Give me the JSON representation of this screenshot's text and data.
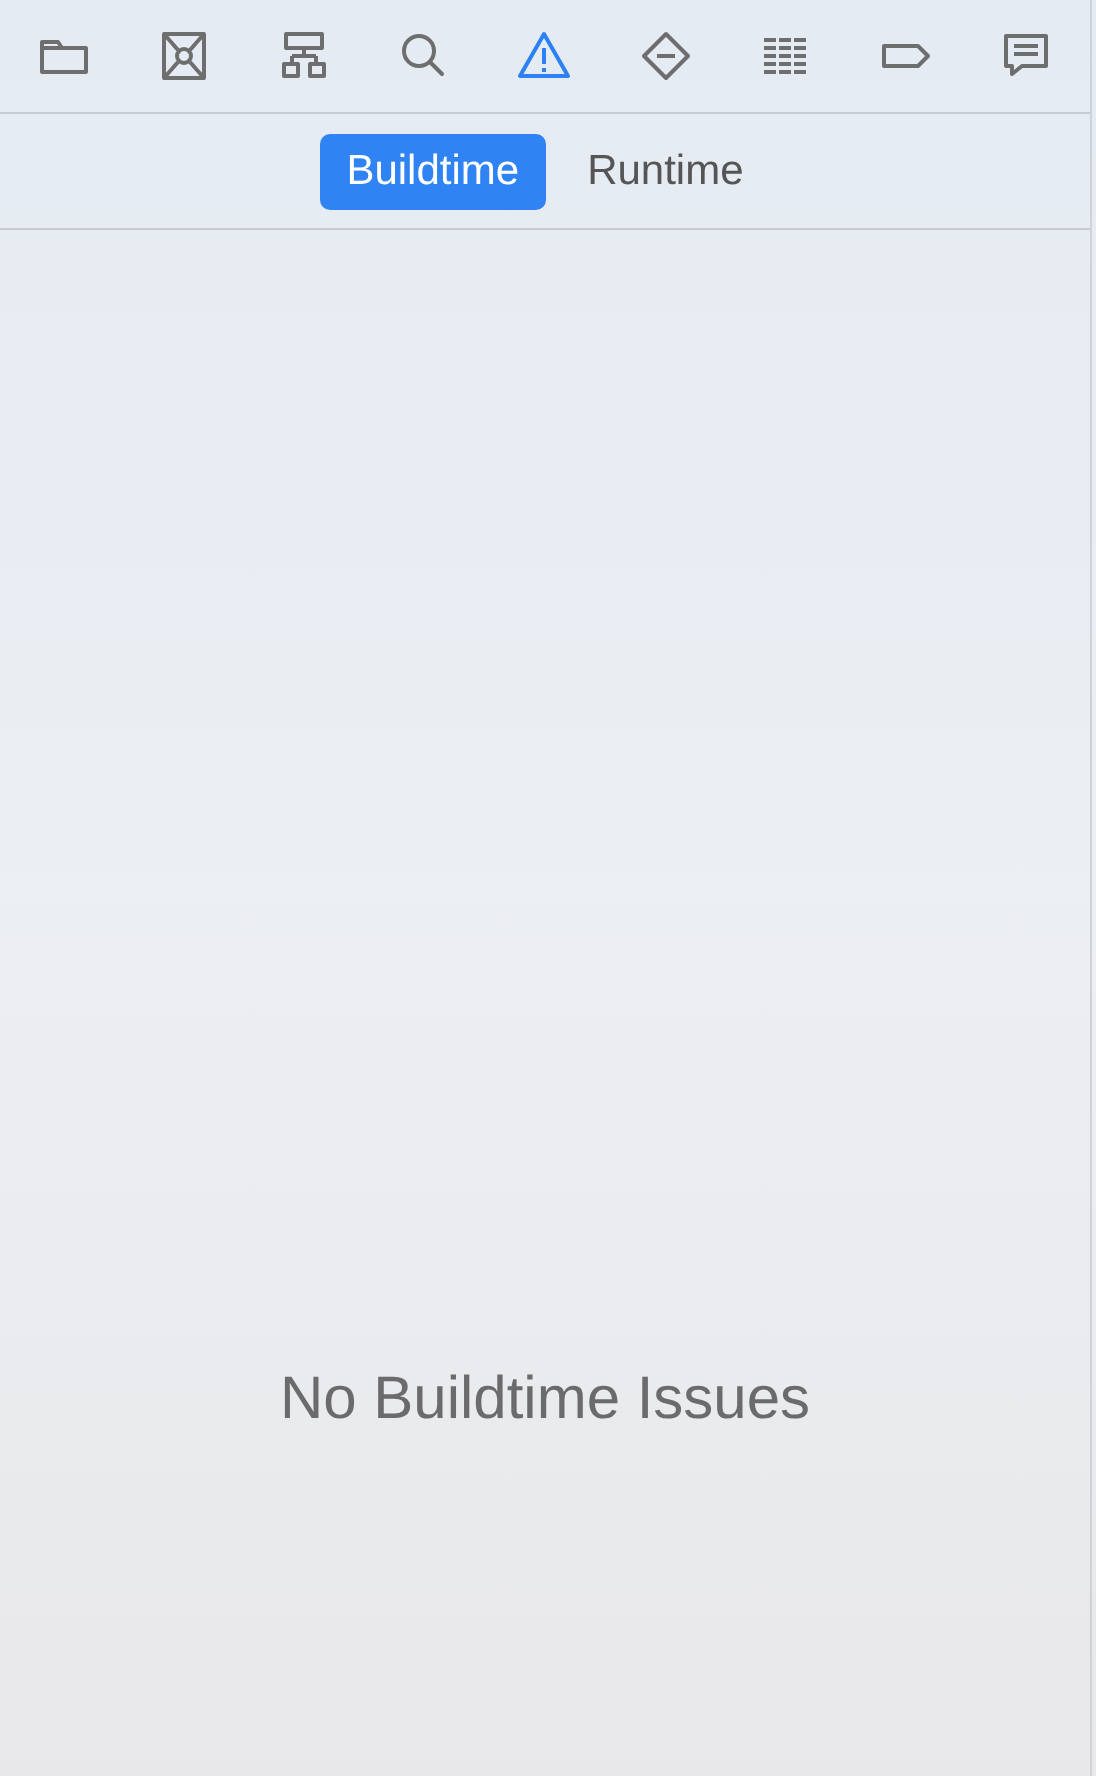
{
  "navigator_tabs": [
    {
      "kind": "folder",
      "selected": false
    },
    {
      "kind": "symbol",
      "selected": false
    },
    {
      "kind": "hierarchy",
      "selected": false
    },
    {
      "kind": "search",
      "selected": false
    },
    {
      "kind": "warning",
      "selected": true
    },
    {
      "kind": "diamond",
      "selected": false
    },
    {
      "kind": "lines",
      "selected": false
    },
    {
      "kind": "tag",
      "selected": false
    },
    {
      "kind": "speech",
      "selected": false
    }
  ],
  "segments": [
    {
      "label": "Buildtime",
      "selected": true
    },
    {
      "label": "Runtime",
      "selected": false
    }
  ],
  "empty_message": "No Buildtime Issues"
}
